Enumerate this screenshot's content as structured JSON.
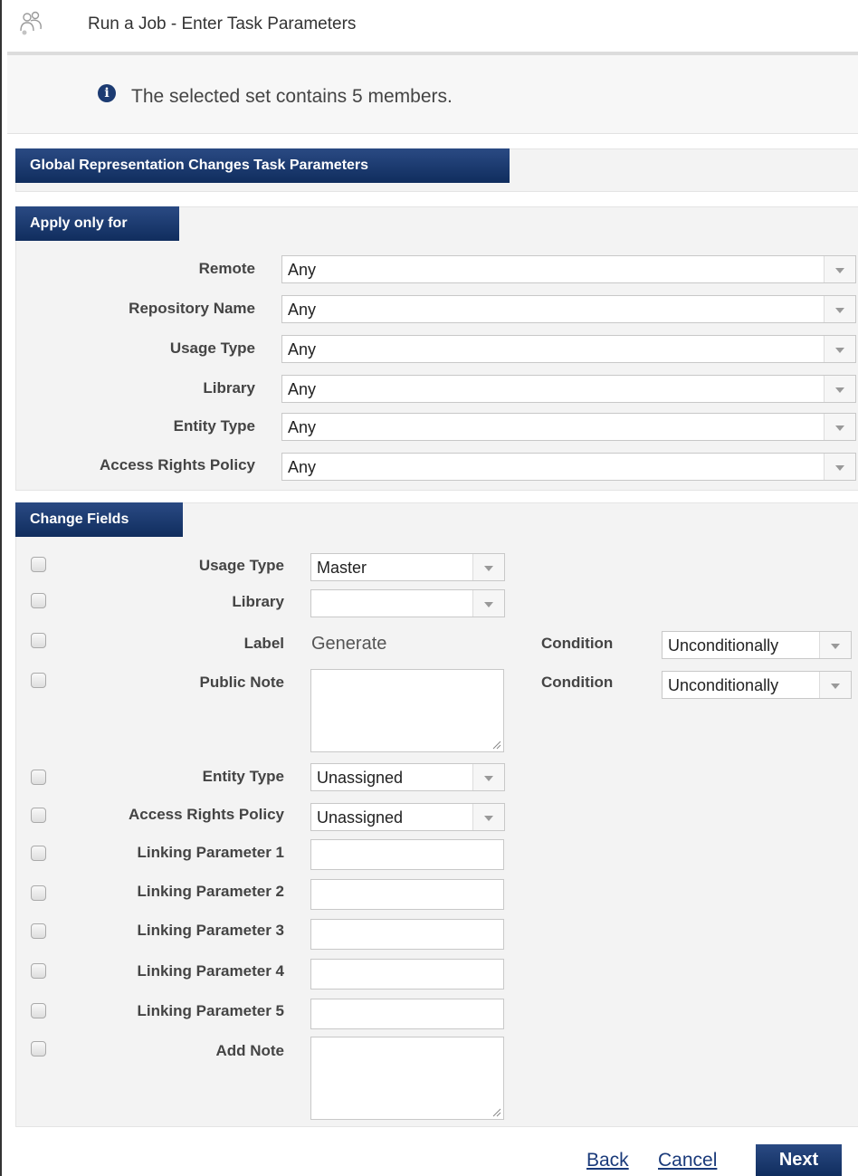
{
  "header": {
    "title": "Run a Job - Enter Task Parameters",
    "icon": "users-group-icon"
  },
  "info": {
    "icon": "info-icon",
    "icon_glyph": "i",
    "message": "The selected set contains 5 members."
  },
  "task_section": {
    "title": "Global Representation Changes Task Parameters"
  },
  "apply_section": {
    "title": "Apply only for",
    "fields": [
      {
        "label": "Remote",
        "value": "Any"
      },
      {
        "label": "Repository Name",
        "value": "Any"
      },
      {
        "label": "Usage Type",
        "value": "Any"
      },
      {
        "label": "Library",
        "value": "Any"
      },
      {
        "label": "Entity Type",
        "value": "Any"
      },
      {
        "label": "Access Rights Policy",
        "value": "Any"
      }
    ]
  },
  "change_section": {
    "title": "Change Fields",
    "usage_type": {
      "label": "Usage Type",
      "value": "Master"
    },
    "library": {
      "label": "Library",
      "value": ""
    },
    "label_field": {
      "label": "Label",
      "value": "Generate",
      "condition_label": "Condition",
      "condition_value": "Unconditionally"
    },
    "public_note": {
      "label": "Public Note",
      "value": "",
      "condition_label": "Condition",
      "condition_value": "Unconditionally"
    },
    "entity_type": {
      "label": "Entity Type",
      "value": "Unassigned"
    },
    "access_rights": {
      "label": "Access Rights Policy",
      "value": "Unassigned"
    },
    "linking_params": [
      {
        "label": "Linking Parameter 1",
        "value": ""
      },
      {
        "label": "Linking Parameter 2",
        "value": ""
      },
      {
        "label": "Linking Parameter 3",
        "value": ""
      },
      {
        "label": "Linking Parameter 4",
        "value": ""
      },
      {
        "label": "Linking Parameter 5",
        "value": ""
      }
    ],
    "add_note": {
      "label": "Add Note",
      "value": ""
    }
  },
  "footer": {
    "back": "Back",
    "cancel": "Cancel",
    "next": "Next"
  },
  "colors": {
    "accent": "#1c3b72",
    "section_band": "#f3f3f3",
    "link": "#1a3a7a"
  }
}
